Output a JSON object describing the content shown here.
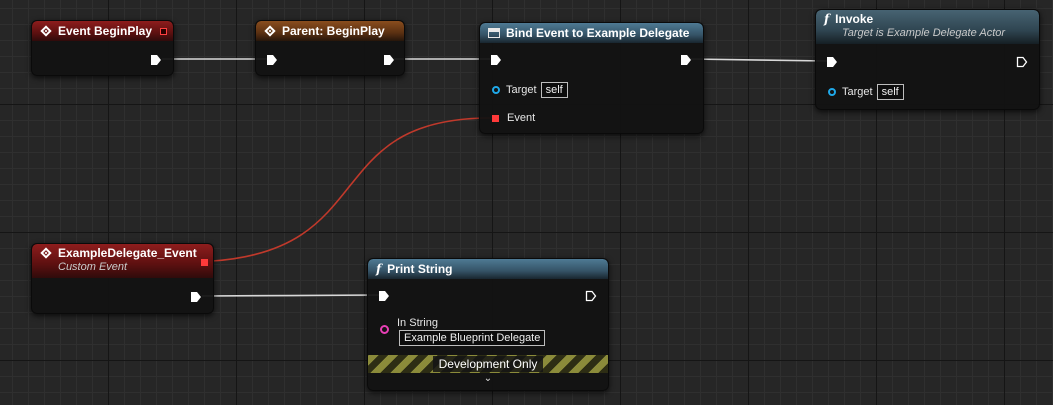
{
  "nodes": {
    "event_begin_play": {
      "title": "Event BeginPlay"
    },
    "parent_begin_play": {
      "title": "Parent: BeginPlay"
    },
    "bind_event": {
      "title": "Bind Event to Example Delegate",
      "target_label": "Target",
      "target_value": "self",
      "event_label": "Event"
    },
    "invoke": {
      "title": "Invoke",
      "subtitle": "Target is Example Delegate Actor",
      "target_label": "Target",
      "target_value": "self"
    },
    "custom_event": {
      "title": "ExampleDelegate_Event",
      "subtitle": "Custom Event"
    },
    "print_string": {
      "title": "Print String",
      "in_string_label": "In String",
      "in_string_value": "Example Blueprint Delegate",
      "dev_label": "Development Only"
    }
  },
  "colors": {
    "event_header": "#8e1d1d",
    "parent_header": "#8a4d1e",
    "function_header": "#4e7a94",
    "object_pin": "#1fa8e8",
    "string_pin": "#e83fb5",
    "delegate_pin": "#ff3a3a",
    "delegate_wire": "#c0392b",
    "exec_wire": "#d8d8d8"
  }
}
